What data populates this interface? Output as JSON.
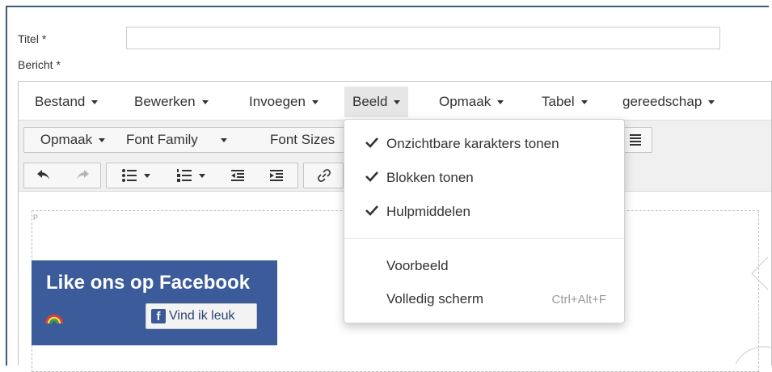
{
  "form": {
    "title_label": "Titel *",
    "title_value": "",
    "body_label": "Bericht *"
  },
  "menubar": {
    "items": [
      {
        "label": "Bestand"
      },
      {
        "label": "Bewerken"
      },
      {
        "label": "Invoegen"
      },
      {
        "label": "Beeld",
        "active": true
      },
      {
        "label": "Opmaak"
      },
      {
        "label": "Tabel"
      },
      {
        "label": "gereedschap"
      }
    ]
  },
  "toolbar": {
    "format_label": "Opmaak",
    "font_family_label": "Font Family",
    "font_sizes_label": "Font Sizes",
    "buttons": [
      "undo-icon",
      "redo-icon",
      "bullet-list-icon",
      "numbered-list-icon",
      "outdent-icon",
      "indent-icon",
      "link-icon",
      "align-justify-icon"
    ]
  },
  "content": {
    "block_tag": "P",
    "facebook": {
      "title": "Like ons op Facebook",
      "like_button": "Vind ik leuk",
      "like_icon_letter": "f",
      "brand_color": "#3b5b9a"
    }
  },
  "view_menu": {
    "items": [
      {
        "label": "Onzichtbare karakters tonen",
        "checked": true
      },
      {
        "label": "Blokken tonen",
        "checked": true
      },
      {
        "label": "Hulpmiddelen",
        "checked": true
      },
      {
        "label": "Voorbeeld",
        "checked": false
      },
      {
        "label": "Volledig scherm",
        "checked": false,
        "shortcut": "Ctrl+Alt+F"
      }
    ]
  }
}
